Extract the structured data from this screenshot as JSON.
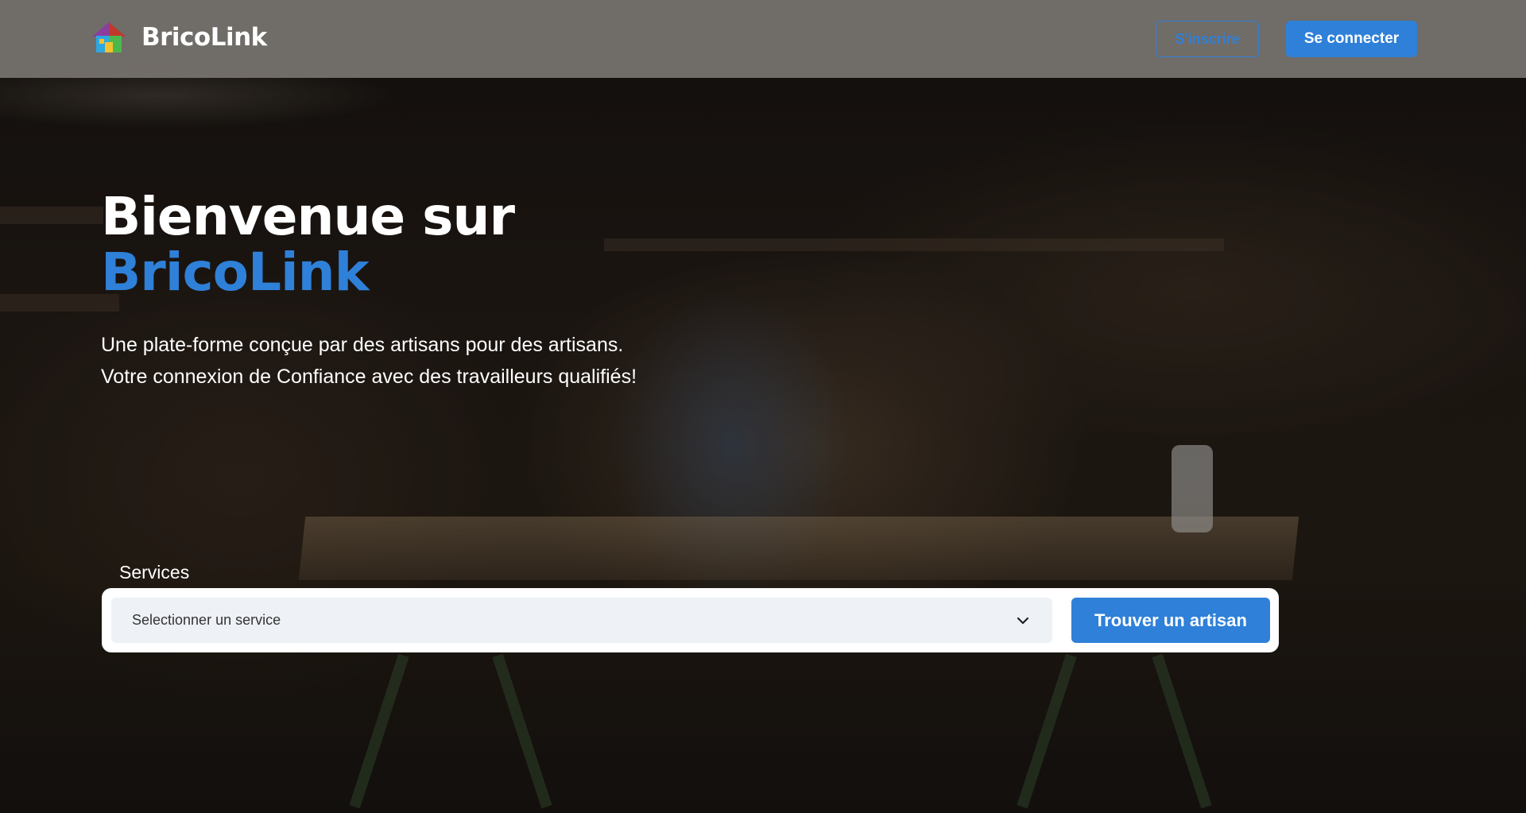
{
  "header": {
    "brand_name": "BricoLink",
    "signup_label": "S'inscrire",
    "login_label": "Se connecter"
  },
  "hero": {
    "title_line1": "Bienvenue sur",
    "title_line2": "BricoLink",
    "subtitle_line1": "Une plate-forme conçue par des artisans pour des artisans.",
    "subtitle_line2": "Votre connexion de Confiance avec des travailleurs qualifiés!"
  },
  "search": {
    "label": "Services",
    "select_value": "Selectionner un service",
    "submit_label": "Trouver un artisan"
  },
  "icons": {
    "logo": "house-icon",
    "dropdown": "chevron-down-icon"
  },
  "colors": {
    "accent": "#2f80d8",
    "header_bg": "#78746f",
    "text_light": "#ffffff"
  }
}
